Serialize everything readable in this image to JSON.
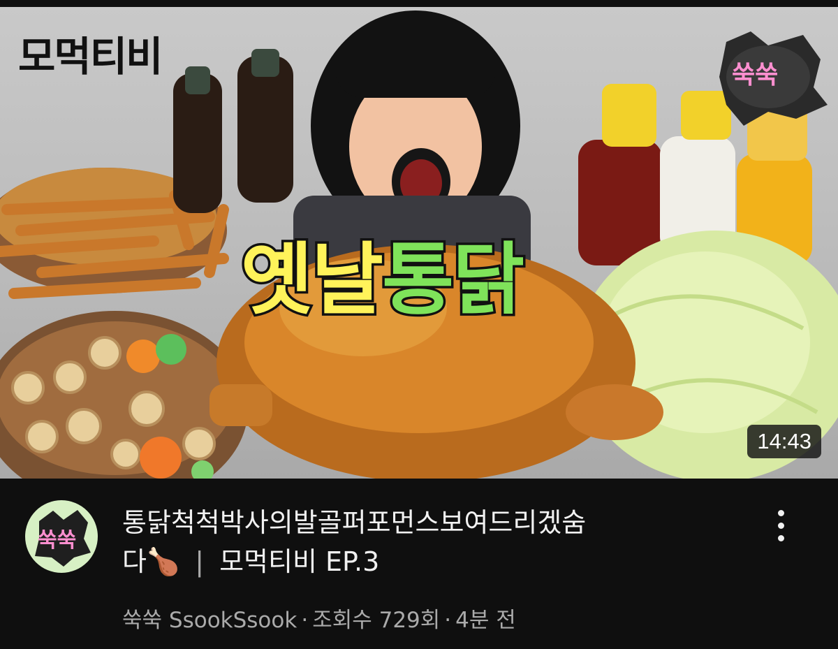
{
  "thumbnail": {
    "channel_logo_text": "모먹티비",
    "headline_part1": "옛날",
    "headline_part2": "통닭",
    "duration": "14:43",
    "sticker_text": "쑥쑥"
  },
  "video": {
    "title_line1": "통닭척척박사의발골퍼포먼스보여드리겠숨",
    "title_line2_start": "다🍗",
    "title_separator": "|",
    "title_line2_end": "모먹티비 EP.3",
    "channel_name": "쑥쑥 SsookSsook",
    "views": "조회수 729회",
    "time_ago": "4분 전",
    "meta_separator": "·"
  },
  "avatar": {
    "text": "쑥쑥"
  },
  "icons": {
    "more": "more-vert-icon"
  },
  "colors": {
    "background": "#0f0f0f",
    "title_text": "#f1f1f1",
    "meta_text": "#aaaaaa",
    "headline_yellow": "#fff35a",
    "headline_green": "#7fe35a"
  }
}
